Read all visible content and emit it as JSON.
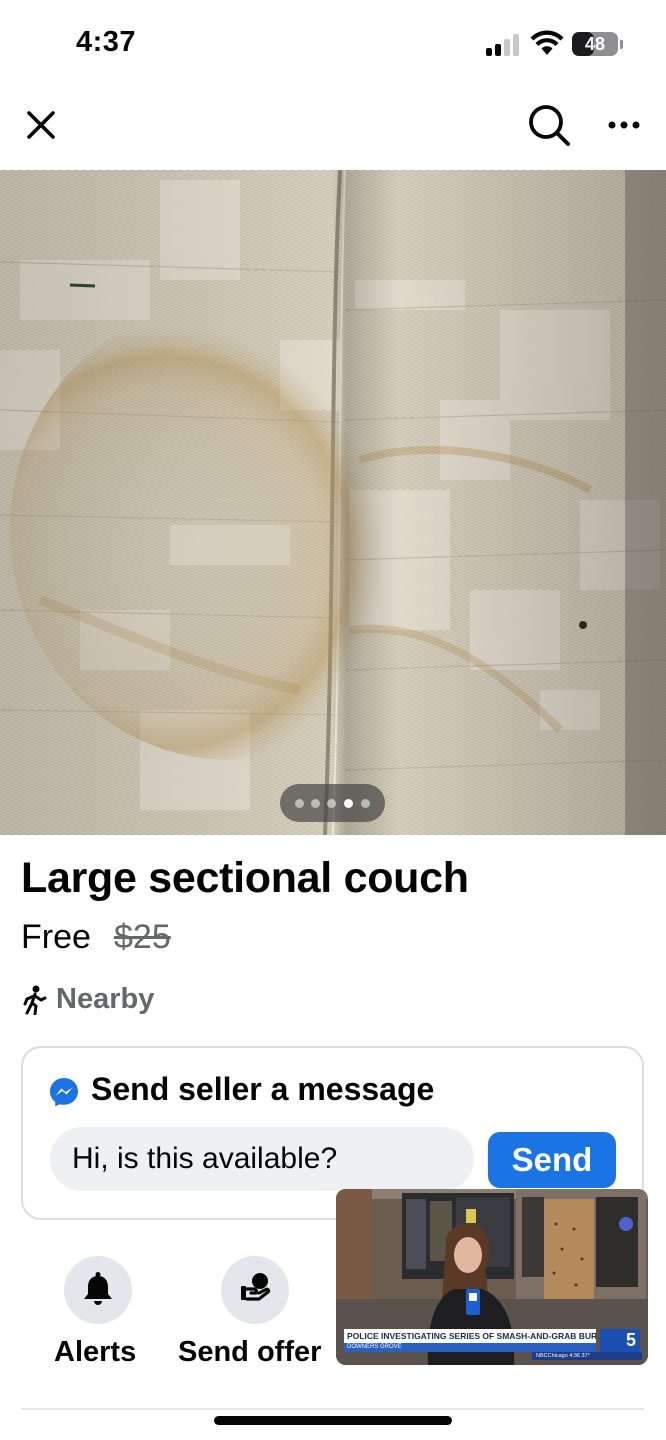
{
  "status_bar": {
    "time": "4:37",
    "battery_level": "48",
    "signal_icon": "cellular-signal-icon",
    "wifi_icon": "wifi-icon"
  },
  "nav": {
    "close_icon": "close-icon",
    "search_icon": "search-icon",
    "more_icon": "more-options-icon"
  },
  "photo": {
    "pager_count": 5,
    "pager_active_index": 3
  },
  "listing": {
    "title": "Large sectional couch",
    "price": "Free",
    "original_price": "$25",
    "distance": "Nearby"
  },
  "message": {
    "title": "Send seller a message",
    "input_value": "Hi, is this available?",
    "send_label": "Send"
  },
  "actions": [
    {
      "label": "Alerts",
      "icon": "bell-icon"
    },
    {
      "label": "Send offer",
      "icon": "send-offer-icon"
    }
  ],
  "video": {
    "chyron": "POLICE INVESTIGATING SERIES OF SMASH-AND-GRAB BURGLARIES",
    "location": "DOWNERS GROVE",
    "channel": "5",
    "ticker": "NBCChicago 4:36 37°"
  },
  "colors": {
    "accent": "#1b74e4",
    "secondary_text": "#65676b",
    "card_border": "#dcdde1",
    "action_bg": "#e4e6eb"
  }
}
